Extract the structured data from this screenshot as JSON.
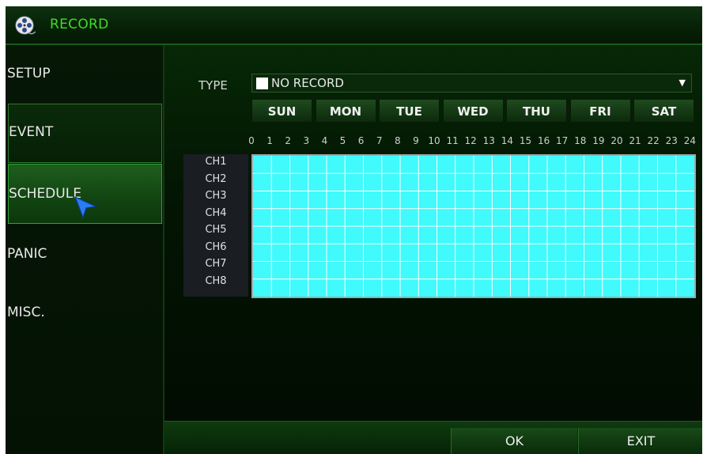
{
  "window": {
    "title": "RECORD",
    "icon": "film-reel-icon"
  },
  "sidebar": {
    "items": [
      {
        "label": "SETUP",
        "selected": false
      },
      {
        "label": "EVENT",
        "selected": false
      },
      {
        "label": "SCHEDULE",
        "selected": true
      },
      {
        "label": "PANIC",
        "selected": false
      },
      {
        "label": "MISC.",
        "selected": false
      }
    ]
  },
  "type": {
    "label": "TYPE",
    "value": "NO RECORD",
    "swatch_color": "#ffffff"
  },
  "days": [
    "SUN",
    "MON",
    "TUE",
    "WED",
    "THU",
    "FRI",
    "SAT"
  ],
  "hours": [
    "0",
    "1",
    "2",
    "3",
    "4",
    "5",
    "6",
    "7",
    "8",
    "9",
    "10",
    "11",
    "12",
    "13",
    "14",
    "15",
    "16",
    "17",
    "18",
    "19",
    "20",
    "21",
    "22",
    "23",
    "24"
  ],
  "channels": [
    "CH1",
    "CH2",
    "CH3",
    "CH4",
    "CH5",
    "CH6",
    "CH7",
    "CH8"
  ],
  "schedule": {
    "fill_color": "#40fafc",
    "state": "all cells filled"
  },
  "footer": {
    "ok_label": "OK",
    "exit_label": "EXIT"
  },
  "colors": {
    "accent": "#3fdc2a",
    "background": "#020c02"
  }
}
